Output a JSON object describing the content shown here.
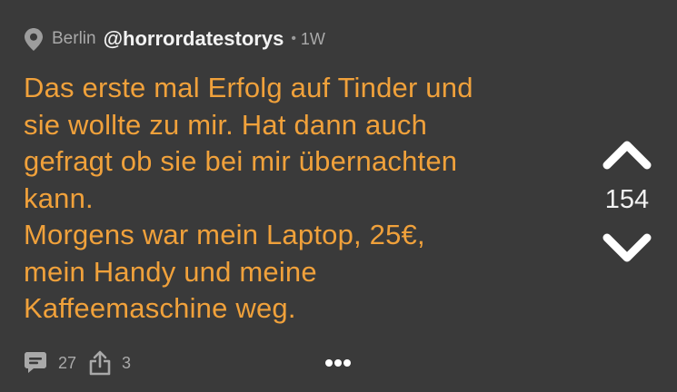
{
  "header": {
    "location_icon": "map-pin-icon",
    "location": "Berlin",
    "username": "@horrordatestorys",
    "separator": "•",
    "age": "1W"
  },
  "post": {
    "lines": [
      "Das erste mal Erfolg auf Tinder und",
      "sie wollte zu mir. Hat dann auch",
      "gefragt ob sie bei mir übernachten",
      "kann.",
      "Morgens war mein Laptop, 25€,",
      "mein Handy und meine",
      "Kaffeemaschine weg."
    ],
    "text_color": "#f0a13b"
  },
  "vote": {
    "upvote_icon": "chevron-up-icon",
    "score": "154",
    "downvote_icon": "chevron-down-icon"
  },
  "footer": {
    "comment_icon": "comment-icon",
    "comment_count": "27",
    "share_icon": "share-icon",
    "share_count": "3",
    "more_icon": "more-options-icon"
  },
  "colors": {
    "background": "#3a3a3a",
    "accent": "#f0a13b",
    "muted": "#a9a9a9",
    "primary_text": "#f2f2f2"
  }
}
